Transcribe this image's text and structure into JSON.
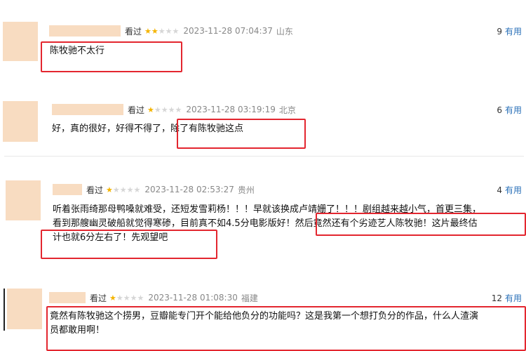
{
  "reviews": [
    {
      "status": "看过",
      "rating": 2,
      "time": "2023-11-28 07:04:37",
      "location": "山东",
      "vote_count": "9",
      "vote_label": "有用",
      "lines": [
        "陈牧驰不太行"
      ]
    },
    {
      "status": "看过",
      "rating": 1,
      "time": "2023-11-28 03:19:19",
      "location": "北京",
      "vote_count": "6",
      "vote_label": "有用",
      "lines": [
        "好，真的很好，好得不得了，除了有陈牧驰这点"
      ]
    },
    {
      "status": "看过",
      "rating": 1,
      "time": "2023-11-28 02:53:27",
      "location": "贵州",
      "vote_count": "4",
      "vote_label": "有用",
      "lines": [
        "听着张雨绮那母鸭嗓就难受，还短发雪莉杨！！！早就该换成卢靖姗了！！！剧组越来越小气，首更三集，",
        "看到那艘幽灵破船就觉得寒碜，目前真不如4.5分电影版好！然后竟然还有个劣迹艺人陈牧驰！这片最终估",
        "计也就6分左右了！先观望吧"
      ]
    },
    {
      "status": "看过",
      "rating": 1,
      "time": "2023-11-28 01:08:30",
      "location": "福建",
      "vote_count": "12",
      "vote_label": "有用",
      "lines": [
        "竟然有陈牧驰这个捞男，豆瓣能专门开个能给他负分的功能吗？这是我第一个想打负分的作品，什么人渣演",
        "员都敢用啊！"
      ]
    }
  ],
  "colors": {
    "star_on": "#f4b400",
    "star_off": "#d6d6d6",
    "highlight": "#e3262f",
    "link": "#2a70b8",
    "avatar_placeholder": "#f8dcc1"
  }
}
